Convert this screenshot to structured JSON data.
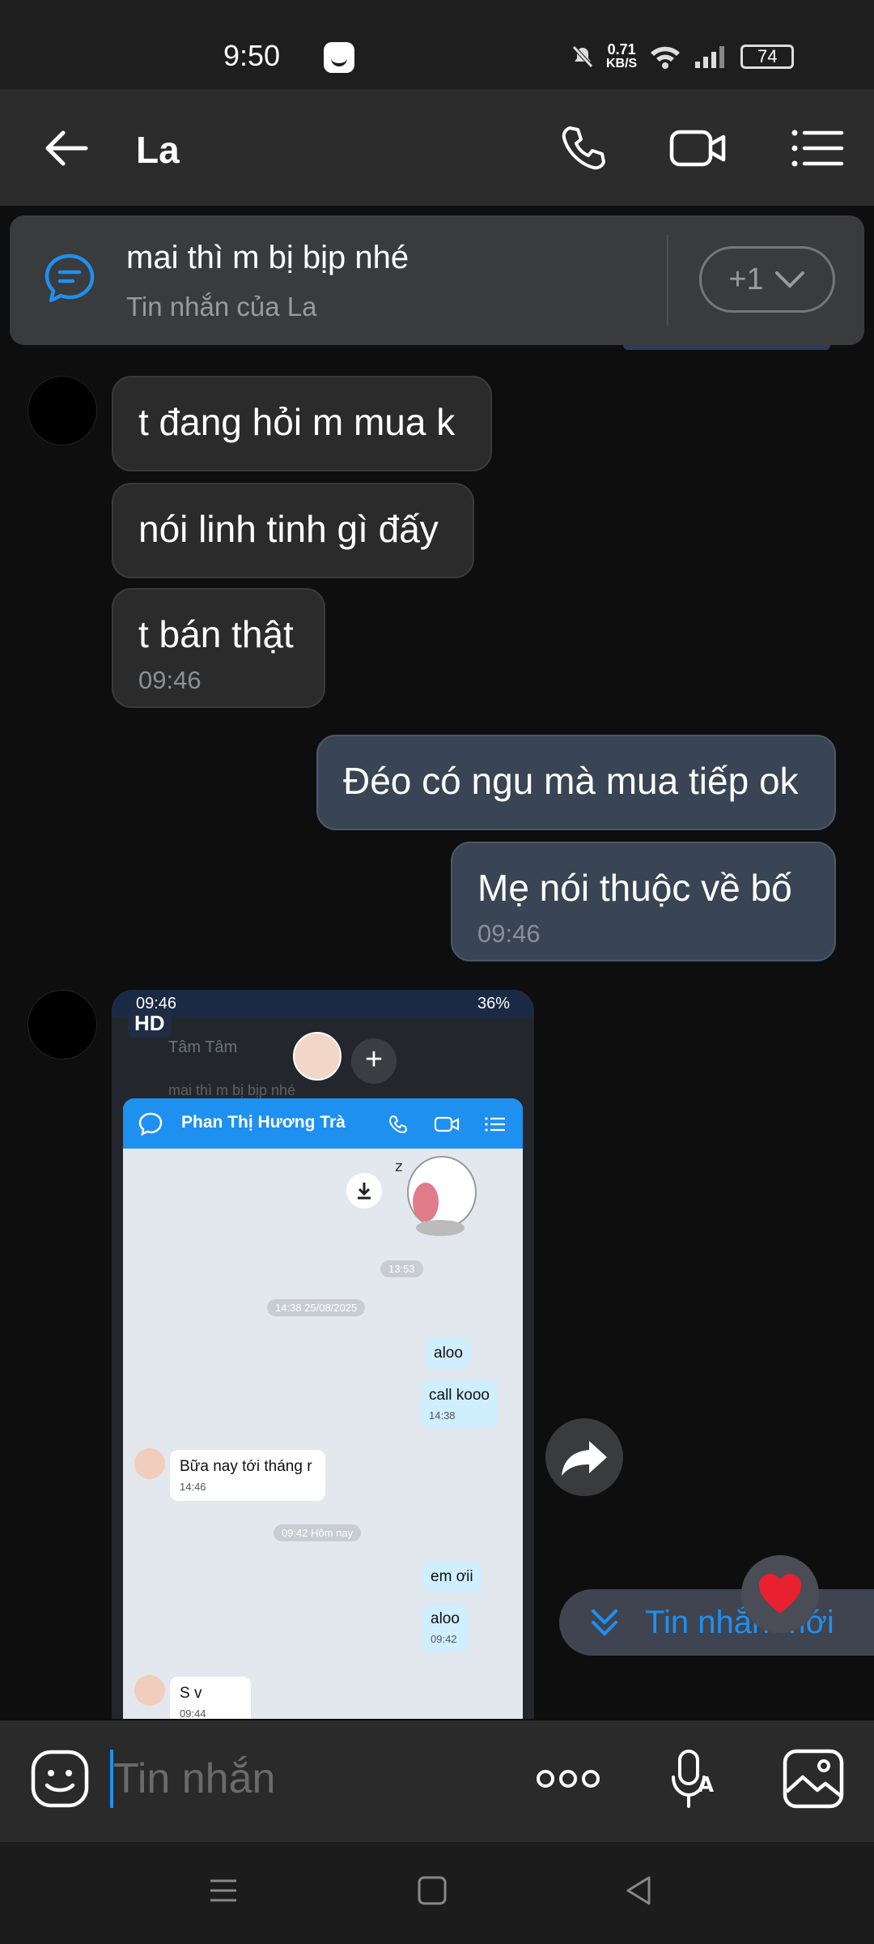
{
  "status_bar": {
    "time": "9:50",
    "speed_value": "0.71",
    "speed_unit": "KB/S",
    "battery": "74"
  },
  "header": {
    "title": "La",
    "back_icon": "arrow-left-icon",
    "call_icon": "phone-icon",
    "video_icon": "video-camera-icon",
    "menu_icon": "list-icon"
  },
  "pinned": {
    "text": "mai thì m bị bịp nhé",
    "sender": "Tin nhắn của La",
    "more": "+1"
  },
  "messages": [
    {
      "text": "t đang hỏi m mua k"
    },
    {
      "text": "nói linh tinh gì đấy"
    },
    {
      "text": "t bán thật",
      "time": "09:46"
    },
    {
      "text": "Đéo có ngu mà mua tiếp ok"
    },
    {
      "text": "Mẹ nói thuộc về bố",
      "time": "09:46"
    }
  ],
  "image_message": {
    "badge": "HD",
    "status_time": "09:46",
    "status_battery": "36%",
    "peek_name": "Tâm Tâm",
    "peek_pinned": "mai thì m bị bịp nhé",
    "contact": "Phan Thị Hương Trà",
    "time_1": "13:53",
    "date_pill": "14:38 25/08/2025",
    "msg_aloo": "aloo",
    "msg_call": "call kooo",
    "time_call": "14:38",
    "msg_bua": "Bữa nay tới tháng r",
    "time_bua": "14:46",
    "today_pill": "09:42 Hôm nay",
    "msg_emoi": "em ơii",
    "msg_aloo2": "aloo",
    "time_aloo2": "09:42",
    "msg_sv": "S v",
    "time_sv": "09:44"
  },
  "new_messages_label": "Tin nhắn mới",
  "input": {
    "placeholder": "Tin nhắn"
  },
  "colors": {
    "accent": "#1e90f0",
    "incoming": "#2b2b2b",
    "outgoing": "#394554"
  }
}
